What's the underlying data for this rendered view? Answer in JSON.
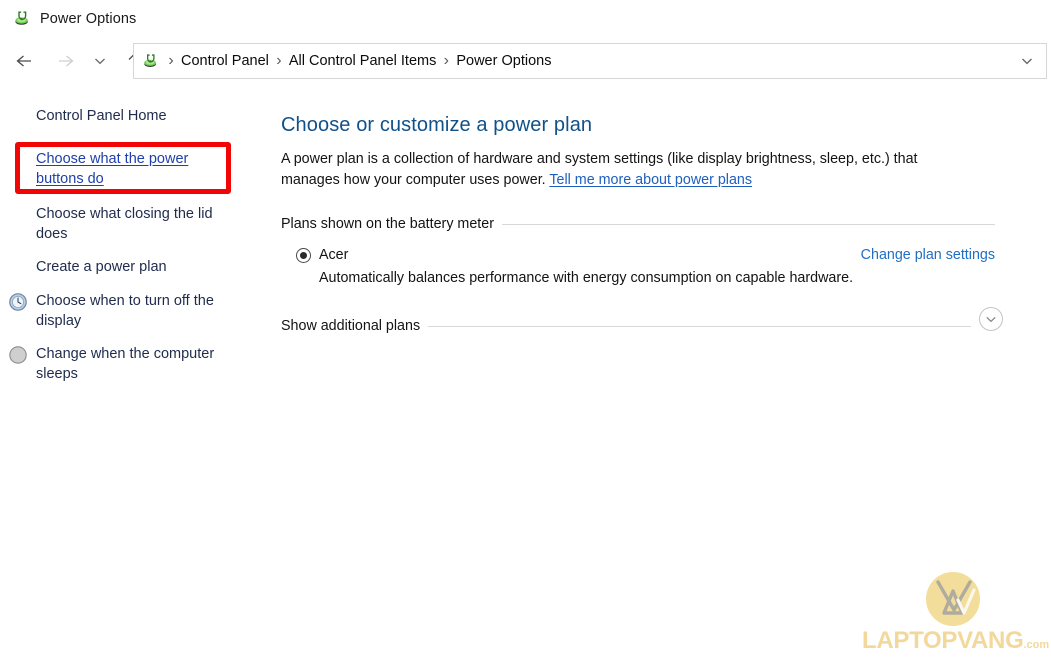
{
  "window": {
    "title": "Power Options",
    "icon": "power-plug-icon"
  },
  "navigation": {
    "back": "back-arrow",
    "forward": "forward-arrow",
    "recent": "chevron-down",
    "up": "up-arrow",
    "address_dropdown": "chevron-down",
    "breadcrumbs": [
      {
        "label": "Control Panel"
      },
      {
        "label": "All Control Panel Items"
      },
      {
        "label": "Power Options"
      }
    ],
    "separator": "›"
  },
  "sidebar": {
    "items": [
      {
        "label": "Control Panel Home",
        "icon": "none",
        "highlighted": false,
        "underlined": false
      },
      {
        "label": "Choose what the power buttons do",
        "icon": "none",
        "highlighted": true,
        "underlined": true
      },
      {
        "label": "Choose what closing the lid does",
        "icon": "none",
        "highlighted": false,
        "underlined": false
      },
      {
        "label": "Create a power plan",
        "icon": "none",
        "highlighted": false,
        "underlined": false
      },
      {
        "label": "Choose when to turn off the display",
        "icon": "clock-icon",
        "highlighted": false,
        "underlined": false
      },
      {
        "label": "Change when the computer sleeps",
        "icon": "moon-sleep-icon",
        "highlighted": false,
        "underlined": false
      }
    ],
    "highlight_color": "#f20505"
  },
  "main": {
    "heading": "Choose or customize a power plan",
    "description_part1": "A power plan is a collection of hardware and system settings (like display brightness, sleep, etc.) that manages how your computer uses power. ",
    "description_link": "Tell me more about power plans",
    "battery_group_label": "Plans shown on the battery meter",
    "plan": {
      "name": "Acer",
      "selected": true,
      "description": "Automatically balances performance with energy consumption on capable hardware.",
      "settings_link": "Change plan settings"
    },
    "additional_group_label": "Show additional plans",
    "expand_icon": "chevron-down-icon"
  },
  "watermark": {
    "brand": "LAPTOPVANG",
    "suffix": ".com",
    "color": "#e9b949"
  },
  "colors": {
    "heading": "#11518a",
    "link": "#1f5fbf",
    "sidebar_text": "#1f2b4d",
    "accent_red": "#f20505"
  }
}
